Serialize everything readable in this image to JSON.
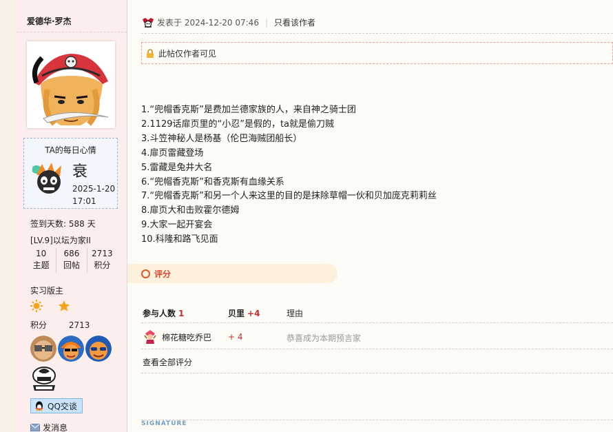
{
  "author": {
    "username": "爱德华·罗杰",
    "mood_title": "TA的每日心情",
    "mood_char": "衰",
    "mood_date": "2025-1-20",
    "mood_time": "17:01",
    "signin": "签到天数: 588 天",
    "level": "[LV.9]以坛为家II",
    "stats": [
      {
        "value": "10",
        "label": "主题"
      },
      {
        "value": "686",
        "label": "回帖"
      },
      {
        "value": "2713",
        "label": "积分"
      }
    ],
    "role": "实习版主",
    "points_label": "积分",
    "points_value": "2713",
    "qq_label": "QQ交谈",
    "msg_label": "发消息"
  },
  "post": {
    "posted_at": "发表于 2024-12-20 07:46",
    "sep": "|",
    "only_author": "只看该作者",
    "locked_notice": "此帖仅作者可见",
    "lines": [
      "1.“兜帽香克斯”是费加兰德家族的人，来自神之骑士团",
      "2.1129话扉页里的“小忍”是假的，ta就是偷刀贼",
      "3.斗笠神秘人是杨基（伦巴海贼团船长）",
      "4.扉页雷藏登场",
      "5.雷藏是兔井大名",
      "6.“兜帽香克斯”和香克斯有血缘关系",
      "7.“兜帽香克斯”和另一个人来这里的目的是抹除草帽一伙和贝加庞克莉莉丝",
      "8.扉页大和击败霍尔德姆",
      "9.大家一起开宴会",
      "10.科隆和路飞见面"
    ]
  },
  "rating": {
    "title": "评分",
    "participants_label": "参与人数",
    "participants_count": "1",
    "currency_label": "贝里",
    "currency_total": "+4",
    "reason_label": "理由",
    "rows": [
      {
        "user": "棉花糖吃乔巴",
        "score": "+ 4",
        "reason": "恭喜成为本期预言家"
      }
    ],
    "view_all": "查看全部评分"
  },
  "signature_label": "SIGNATURE"
}
